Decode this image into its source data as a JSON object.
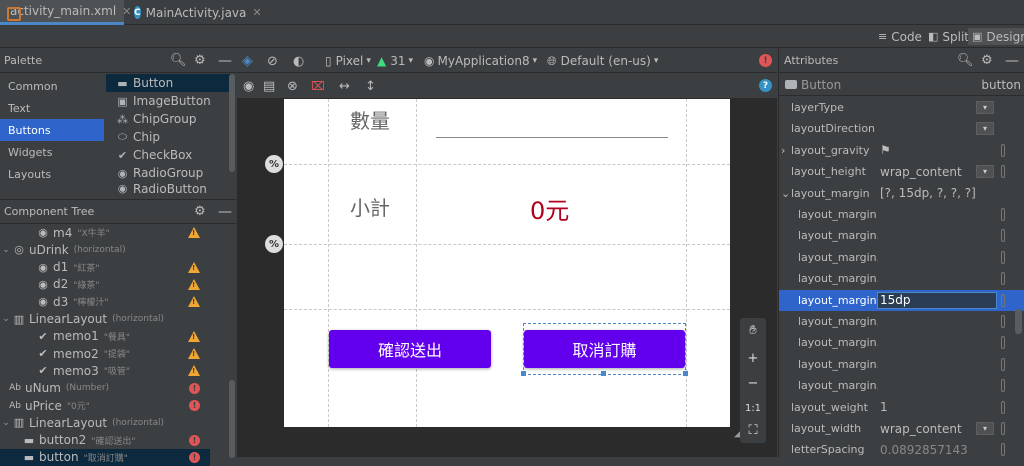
{
  "tabs": [
    {
      "label": "activity_main.xml",
      "active": true
    },
    {
      "label": "MainActivity.java",
      "active": false
    }
  ],
  "view_modes": {
    "code": "Code",
    "split": "Split",
    "design": "Design"
  },
  "palette": {
    "title": "Palette",
    "categories": [
      "Common",
      "Text",
      "Buttons",
      "Widgets",
      "Layouts"
    ],
    "selected_category": "Buttons",
    "items": [
      "Button",
      "ImageButton",
      "ChipGroup",
      "Chip",
      "CheckBox",
      "RadioGroup",
      "RadioButton"
    ]
  },
  "component_tree": {
    "title": "Component Tree",
    "rows": [
      {
        "label": "m4",
        "sub": "\"X牛羊\"",
        "status": "warn"
      },
      {
        "label": "uDrink",
        "sub": "(horizontal)",
        "status": ""
      },
      {
        "label": "d1",
        "sub": "\"紅茶\"",
        "status": "warn"
      },
      {
        "label": "d2",
        "sub": "\"綠茶\"",
        "status": "warn"
      },
      {
        "label": "d3",
        "sub": "\"檸檬汁\"",
        "status": "warn"
      },
      {
        "label": "LinearLayout",
        "sub": "(horizontal)",
        "status": ""
      },
      {
        "label": "memo1",
        "sub": "\"餐具\"",
        "status": "warn"
      },
      {
        "label": "memo2",
        "sub": "\"提袋\"",
        "status": "warn"
      },
      {
        "label": "memo3",
        "sub": "\"吸管\"",
        "status": "warn"
      },
      {
        "label": "uNum",
        "sub": "(Number)",
        "status": "err"
      },
      {
        "label": "uPrice",
        "sub": "\"0元\"",
        "status": "err"
      },
      {
        "label": "LinearLayout",
        "sub": "(horizontal)",
        "status": ""
      },
      {
        "label": "button2",
        "sub": "\"確認送出\"",
        "status": "err"
      },
      {
        "label": "button",
        "sub": "\"取消訂購\"",
        "status": "err"
      }
    ]
  },
  "design_toolbar": {
    "device": "Pixel",
    "api": "31",
    "app": "MyApplication8",
    "locale": "Default (en-us)"
  },
  "preview": {
    "qty_label": "數量",
    "subtotal_label": "小計",
    "subtotal_value": "0元",
    "confirm_button": "確認送出",
    "cancel_button": "取消訂購",
    "percent_badge": "%"
  },
  "zoom_tools": {
    "plus": "+",
    "minus": "−",
    "ratio": "1:1"
  },
  "attributes": {
    "title": "Attributes",
    "widget": "Button",
    "widget_id": "button",
    "rows": [
      {
        "name": "layerType",
        "value": "",
        "dropdown": true,
        "pick": false,
        "selected": false,
        "expander": ""
      },
      {
        "name": "layoutDirection",
        "value": "",
        "dropdown": true,
        "pick": false,
        "selected": false,
        "expander": ""
      },
      {
        "name": "layout_gravity",
        "value": "⚑",
        "dropdown": false,
        "pick": true,
        "selected": false,
        "expander": "›"
      },
      {
        "name": "layout_height",
        "value": "wrap_content",
        "dropdown": true,
        "pick": true,
        "selected": false,
        "expander": ""
      },
      {
        "name": "layout_margin",
        "value": "[?, 15dp, ?, ?, ?]",
        "dropdown": false,
        "pick": false,
        "selected": false,
        "expander": "⌄"
      },
      {
        "name": "layout_margin",
        "value": "",
        "dropdown": false,
        "pick": true,
        "selected": false,
        "expander": ""
      },
      {
        "name": "layout_margin...",
        "value": "",
        "dropdown": false,
        "pick": true,
        "selected": false,
        "expander": ""
      },
      {
        "name": "layout_margin...",
        "value": "",
        "dropdown": false,
        "pick": true,
        "selected": false,
        "expander": ""
      },
      {
        "name": "layout_margin...",
        "value": "",
        "dropdown": false,
        "pick": true,
        "selected": false,
        "expander": ""
      },
      {
        "name": "layout_margin...",
        "value": "15dp",
        "dropdown": false,
        "pick": true,
        "selected": true,
        "expander": ""
      },
      {
        "name": "layout_margin...",
        "value": "",
        "dropdown": false,
        "pick": true,
        "selected": false,
        "expander": ""
      },
      {
        "name": "layout_margin...",
        "value": "",
        "dropdown": false,
        "pick": true,
        "selected": false,
        "expander": ""
      },
      {
        "name": "layout_margin...",
        "value": "",
        "dropdown": false,
        "pick": true,
        "selected": false,
        "expander": ""
      },
      {
        "name": "layout_margin...",
        "value": "",
        "dropdown": false,
        "pick": true,
        "selected": false,
        "expander": ""
      },
      {
        "name": "layout_weight",
        "value": "1",
        "dropdown": false,
        "pick": true,
        "selected": false,
        "expander": ""
      },
      {
        "name": "layout_width",
        "value": "wrap_content",
        "dropdown": true,
        "pick": true,
        "selected": false,
        "expander": ""
      },
      {
        "name": "letterSpacing",
        "value": "0.0892857143",
        "dropdown": false,
        "pick": true,
        "selected": false,
        "expander": ""
      }
    ]
  },
  "colors": {
    "accent": "#2f65ca",
    "button": "#6200ee",
    "price": "#b00020",
    "warn": "#f0a732",
    "error": "#e05555"
  }
}
